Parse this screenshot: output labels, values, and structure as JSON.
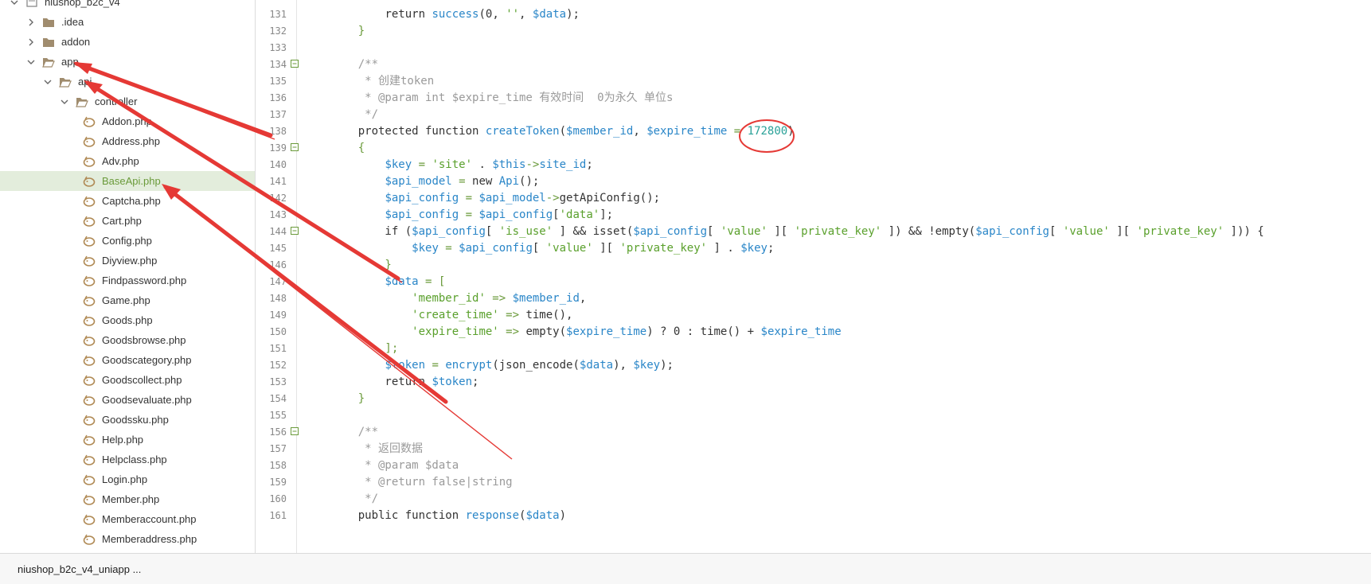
{
  "sidebar": {
    "items": [
      {
        "label": "niushop_b2c_v4",
        "type": "project",
        "expanded": true,
        "depth": 0
      },
      {
        "label": ".idea",
        "type": "folder",
        "expanded": false,
        "depth": 1
      },
      {
        "label": "addon",
        "type": "folder",
        "expanded": false,
        "depth": 1
      },
      {
        "label": "app",
        "type": "folder",
        "expanded": true,
        "depth": 1
      },
      {
        "label": "api",
        "type": "folder",
        "expanded": true,
        "depth": 2
      },
      {
        "label": "controller",
        "type": "folder",
        "expanded": true,
        "depth": 3
      },
      {
        "label": "Addon.php",
        "type": "php",
        "depth": 4
      },
      {
        "label": "Address.php",
        "type": "php",
        "depth": 4
      },
      {
        "label": "Adv.php",
        "type": "php",
        "depth": 4
      },
      {
        "label": "BaseApi.php",
        "type": "php",
        "depth": 4,
        "selected": true
      },
      {
        "label": "Captcha.php",
        "type": "php",
        "depth": 4
      },
      {
        "label": "Cart.php",
        "type": "php",
        "depth": 4
      },
      {
        "label": "Config.php",
        "type": "php",
        "depth": 4
      },
      {
        "label": "Diyview.php",
        "type": "php",
        "depth": 4
      },
      {
        "label": "Findpassword.php",
        "type": "php",
        "depth": 4
      },
      {
        "label": "Game.php",
        "type": "php",
        "depth": 4
      },
      {
        "label": "Goods.php",
        "type": "php",
        "depth": 4
      },
      {
        "label": "Goodsbrowse.php",
        "type": "php",
        "depth": 4
      },
      {
        "label": "Goodscategory.php",
        "type": "php",
        "depth": 4
      },
      {
        "label": "Goodscollect.php",
        "type": "php",
        "depth": 4
      },
      {
        "label": "Goodsevaluate.php",
        "type": "php",
        "depth": 4
      },
      {
        "label": "Goodssku.php",
        "type": "php",
        "depth": 4
      },
      {
        "label": "Help.php",
        "type": "php",
        "depth": 4
      },
      {
        "label": "Helpclass.php",
        "type": "php",
        "depth": 4
      },
      {
        "label": "Login.php",
        "type": "php",
        "depth": 4
      },
      {
        "label": "Member.php",
        "type": "php",
        "depth": 4
      },
      {
        "label": "Memberaccount.php",
        "type": "php",
        "depth": 4
      },
      {
        "label": "Memberaddress.php",
        "type": "php",
        "depth": 4
      }
    ]
  },
  "editor": {
    "lines": [
      {
        "n": "131",
        "fold": false,
        "tokens": [
          [
            "        ",
            "punc"
          ],
          [
            "return ",
            "kw"
          ],
          [
            "success",
            "fn"
          ],
          [
            "(0, ",
            "punc"
          ],
          [
            "''",
            "str"
          ],
          [
            ", ",
            "punc"
          ],
          [
            "$data",
            "var"
          ],
          [
            ");",
            "punc"
          ]
        ]
      },
      {
        "n": "132",
        "fold": false,
        "tokens": [
          [
            "    }",
            "op"
          ]
        ]
      },
      {
        "n": "133",
        "fold": false,
        "tokens": []
      },
      {
        "n": "134",
        "fold": true,
        "tokens": [
          [
            "    /**",
            "cmt"
          ]
        ]
      },
      {
        "n": "135",
        "fold": false,
        "tokens": [
          [
            "     * 创建token",
            "cmt"
          ]
        ]
      },
      {
        "n": "136",
        "fold": false,
        "tokens": [
          [
            "     * @param int $expire_time 有效时间  0为永久 单位s",
            "cmt"
          ]
        ]
      },
      {
        "n": "137",
        "fold": false,
        "tokens": [
          [
            "     */",
            "cmt"
          ]
        ]
      },
      {
        "n": "138",
        "fold": false,
        "tokens": [
          [
            "    protected function ",
            "kw"
          ],
          [
            "createToken",
            "fn"
          ],
          [
            "(",
            "punc"
          ],
          [
            "$member_id",
            "var"
          ],
          [
            ", ",
            "punc"
          ],
          [
            "$expire_time",
            "var"
          ],
          [
            " = ",
            "op"
          ],
          [
            "172800",
            "num"
          ],
          [
            ")",
            "punc"
          ]
        ]
      },
      {
        "n": "139",
        "fold": true,
        "tokens": [
          [
            "    {",
            "op"
          ]
        ]
      },
      {
        "n": "140",
        "fold": false,
        "tokens": [
          [
            "        ",
            "punc"
          ],
          [
            "$key",
            "var"
          ],
          [
            " = ",
            "op"
          ],
          [
            "'site'",
            "str"
          ],
          [
            " . ",
            "punc"
          ],
          [
            "$this",
            "var"
          ],
          [
            "->",
            "op"
          ],
          [
            "site_id",
            "var"
          ],
          [
            ";",
            "punc"
          ]
        ]
      },
      {
        "n": "141",
        "fold": false,
        "tokens": [
          [
            "        ",
            "punc"
          ],
          [
            "$api_model",
            "var"
          ],
          [
            " = ",
            "op"
          ],
          [
            "new ",
            "kw"
          ],
          [
            "Api",
            "fn"
          ],
          [
            "();",
            "punc"
          ]
        ]
      },
      {
        "n": "142",
        "fold": false,
        "tokens": [
          [
            "        ",
            "punc"
          ],
          [
            "$api_config",
            "var"
          ],
          [
            " = ",
            "op"
          ],
          [
            "$api_model",
            "var"
          ],
          [
            "->",
            "op"
          ],
          [
            "getApiConfig",
            "kw"
          ],
          [
            "();",
            "punc"
          ]
        ]
      },
      {
        "n": "143",
        "fold": false,
        "tokens": [
          [
            "        ",
            "punc"
          ],
          [
            "$api_config",
            "var"
          ],
          [
            " = ",
            "op"
          ],
          [
            "$api_config",
            "var"
          ],
          [
            "[",
            "punc"
          ],
          [
            "'data'",
            "str"
          ],
          [
            "];",
            "punc"
          ]
        ]
      },
      {
        "n": "144",
        "fold": true,
        "tokens": [
          [
            "        if (",
            "kw"
          ],
          [
            "$api_config",
            "var"
          ],
          [
            "[ ",
            "punc"
          ],
          [
            "'is_use'",
            "str"
          ],
          [
            " ] && isset(",
            "kw"
          ],
          [
            "$api_config",
            "var"
          ],
          [
            "[ ",
            "punc"
          ],
          [
            "'value'",
            "str"
          ],
          [
            " ][ ",
            "punc"
          ],
          [
            "'private_key'",
            "str"
          ],
          [
            " ]) && !empty(",
            "kw"
          ],
          [
            "$api_config",
            "var"
          ],
          [
            "[ ",
            "punc"
          ],
          [
            "'value'",
            "str"
          ],
          [
            " ][ ",
            "punc"
          ],
          [
            "'private_key'",
            "str"
          ],
          [
            " ])) {",
            "punc"
          ]
        ]
      },
      {
        "n": "145",
        "fold": false,
        "tokens": [
          [
            "            ",
            "punc"
          ],
          [
            "$key",
            "var"
          ],
          [
            " = ",
            "op"
          ],
          [
            "$api_config",
            "var"
          ],
          [
            "[ ",
            "punc"
          ],
          [
            "'value'",
            "str"
          ],
          [
            " ][ ",
            "punc"
          ],
          [
            "'private_key'",
            "str"
          ],
          [
            " ] . ",
            "punc"
          ],
          [
            "$key",
            "var"
          ],
          [
            ";",
            "punc"
          ]
        ]
      },
      {
        "n": "146",
        "fold": false,
        "tokens": [
          [
            "        }",
            "op"
          ]
        ]
      },
      {
        "n": "147",
        "fold": false,
        "tokens": [
          [
            "        ",
            "punc"
          ],
          [
            "$data",
            "var"
          ],
          [
            " = [",
            "op"
          ]
        ]
      },
      {
        "n": "148",
        "fold": false,
        "tokens": [
          [
            "            ",
            "punc"
          ],
          [
            "'member_id'",
            "str"
          ],
          [
            " => ",
            "op"
          ],
          [
            "$member_id",
            "var"
          ],
          [
            ",",
            "punc"
          ]
        ]
      },
      {
        "n": "149",
        "fold": false,
        "tokens": [
          [
            "            ",
            "punc"
          ],
          [
            "'create_time'",
            "str"
          ],
          [
            " => ",
            "op"
          ],
          [
            "time",
            "kw"
          ],
          [
            "(),",
            "punc"
          ]
        ]
      },
      {
        "n": "150",
        "fold": false,
        "tokens": [
          [
            "            ",
            "punc"
          ],
          [
            "'expire_time'",
            "str"
          ],
          [
            " => ",
            "op"
          ],
          [
            "empty",
            "kw"
          ],
          [
            "(",
            "punc"
          ],
          [
            "$expire_time",
            "var"
          ],
          [
            ") ? 0 : ",
            "punc"
          ],
          [
            "time",
            "kw"
          ],
          [
            "() + ",
            "punc"
          ],
          [
            "$expire_time",
            "var"
          ]
        ]
      },
      {
        "n": "151",
        "fold": false,
        "tokens": [
          [
            "        ];",
            "op"
          ]
        ]
      },
      {
        "n": "152",
        "fold": false,
        "tokens": [
          [
            "        ",
            "punc"
          ],
          [
            "$token",
            "var"
          ],
          [
            " = ",
            "op"
          ],
          [
            "encrypt",
            "fn"
          ],
          [
            "(json_encode(",
            "punc"
          ],
          [
            "$data",
            "var"
          ],
          [
            "), ",
            "punc"
          ],
          [
            "$key",
            "var"
          ],
          [
            ");",
            "punc"
          ]
        ]
      },
      {
        "n": "153",
        "fold": false,
        "tokens": [
          [
            "        return ",
            "kw"
          ],
          [
            "$token",
            "var"
          ],
          [
            ";",
            "punc"
          ]
        ]
      },
      {
        "n": "154",
        "fold": false,
        "tokens": [
          [
            "    }",
            "op"
          ]
        ]
      },
      {
        "n": "155",
        "fold": false,
        "tokens": []
      },
      {
        "n": "156",
        "fold": true,
        "tokens": [
          [
            "    /**",
            "cmt"
          ]
        ]
      },
      {
        "n": "157",
        "fold": false,
        "tokens": [
          [
            "     * 返回数据",
            "cmt"
          ]
        ]
      },
      {
        "n": "158",
        "fold": false,
        "tokens": [
          [
            "     * @param $data",
            "cmt"
          ]
        ]
      },
      {
        "n": "159",
        "fold": false,
        "tokens": [
          [
            "     * @return false|string",
            "cmt"
          ]
        ]
      },
      {
        "n": "160",
        "fold": false,
        "tokens": [
          [
            "     */",
            "cmt"
          ]
        ]
      },
      {
        "n": "161",
        "fold": false,
        "tokens": [
          [
            "    public function ",
            "kw"
          ],
          [
            "response",
            "fn"
          ],
          [
            "(",
            "punc"
          ],
          [
            "$data",
            "var"
          ],
          [
            ")",
            "punc"
          ]
        ]
      }
    ]
  },
  "statusbar": {
    "project": "niushop_b2c_v4_uniapp ..."
  },
  "colors": {
    "accent": "#e53935",
    "selected_row": "#e3eddc",
    "folder": "#a08c6e"
  }
}
